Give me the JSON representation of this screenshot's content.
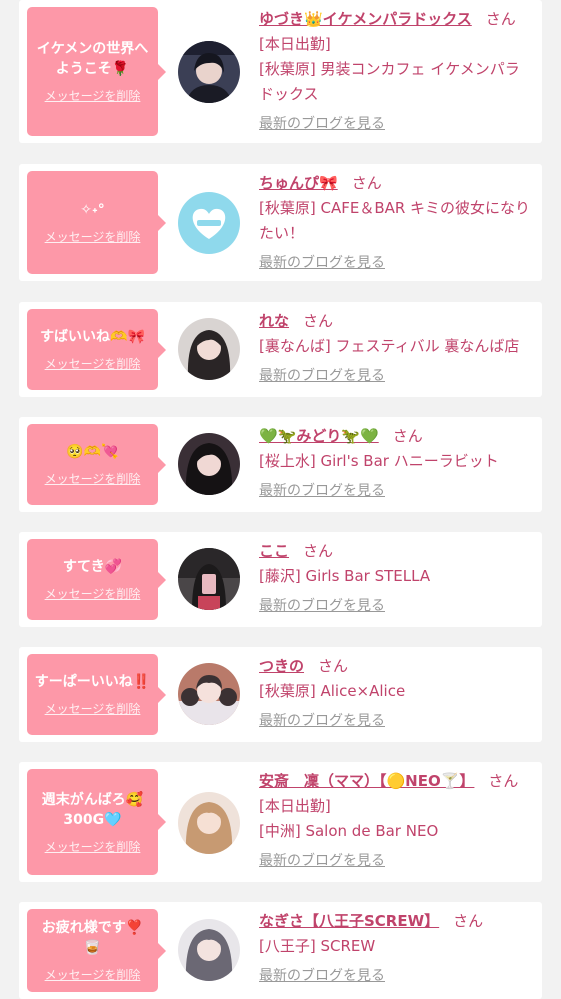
{
  "colors": {
    "page_bg": "#f2f2f2",
    "bubble": "#fd98a8",
    "accent": "#c0436b",
    "muted": "#999999"
  },
  "delete_label": "メッセージを削除",
  "blog_label": "最新のブログを見る",
  "san_label": "さん",
  "messages": [
    {
      "bubble_text": "イケメンの世界へ\nようこそ🌹",
      "name": "ゆづき👑イケメンパラドックス",
      "shop_lines": [
        "[本日出勤]",
        "[秋葉原] 男装コンカフェ イケメンパラドックス"
      ],
      "avatar_icon": "avatar-dark-hair-man"
    },
    {
      "bubble_text": "✧˖°",
      "name": "ちゅんぴ🎀",
      "shop_lines": [
        "[秋葉原] CAFE＆BAR キミの彼女になりたい！"
      ],
      "avatar_icon": "avatar-heart-logo"
    },
    {
      "bubble_text": "すばいいね🫶🎀",
      "name": "れな",
      "shop_lines": [
        "[裏なんば] フェスティバル 裏なんば店"
      ],
      "avatar_icon": "avatar-long-hair-girl"
    },
    {
      "bubble_text": "🥺🫶💘",
      "name": "💚🦖みどり🦖💚",
      "shop_lines": [
        "[桜上水] Girl's Bar ハニーラビット"
      ],
      "avatar_icon": "avatar-dark-hair-girl"
    },
    {
      "bubble_text": "すてき💞",
      "name": "ここ",
      "shop_lines": [
        "[藤沢] Girls Bar STELLA"
      ],
      "avatar_icon": "avatar-mirror-selfie"
    },
    {
      "bubble_text": "すーぱーいいね‼️",
      "name": "つきの",
      "shop_lines": [
        "[秋葉原] Alice×Alice"
      ],
      "avatar_icon": "avatar-twin-tails-girl"
    },
    {
      "bubble_text": "週末がんばろ🥰\n300G🩵",
      "name": "安斎　凜（ママ）【🟡NEO🍸】",
      "shop_lines": [
        "[本日出勤]",
        "[中洲] Salon de Bar NEO"
      ],
      "avatar_icon": "avatar-blonde-girl"
    },
    {
      "bubble_text": "お疲れ様です❣️\n🥃",
      "name": "なぎさ【八王子SCREW】",
      "shop_lines": [
        "[八王子] SCREW"
      ],
      "avatar_icon": "avatar-grey-hair-girl"
    }
  ]
}
